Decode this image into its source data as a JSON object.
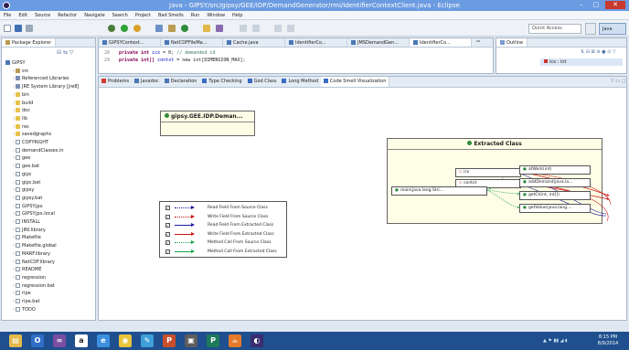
{
  "window": {
    "title": "Java - GIPSY/src/gipsy/GEE/IDP/DemandGenerator/rmi/IdentifierContextClient.java - Eclipse",
    "minimize": "–",
    "maximize": "□",
    "close": "✕"
  },
  "menu": [
    "File",
    "Edit",
    "Source",
    "Refactor",
    "Navigate",
    "Search",
    "Project",
    "Bad Smells",
    "Run",
    "Window",
    "Help"
  ],
  "toolbar": {
    "quick_access": "Quick Access",
    "perspective_java": "Java"
  },
  "package_explorer": {
    "tab": "Package Explorer",
    "tree": [
      {
        "label": "GIPSY",
        "icon": "project-icon",
        "indent": 0
      },
      {
        "label": "src",
        "icon": "package-folder-icon",
        "indent": 1
      },
      {
        "label": "Referenced Libraries",
        "icon": "library-icon",
        "indent": 1
      },
      {
        "label": "JRE System Library [jre8]",
        "icon": "library-icon",
        "indent": 1
      },
      {
        "label": "bin",
        "icon": "folder-icon",
        "indent": 1
      },
      {
        "label": "build",
        "icon": "folder-icon",
        "indent": 1
      },
      {
        "label": "doc",
        "icon": "folder-icon",
        "indent": 1
      },
      {
        "label": "lib",
        "icon": "folder-icon",
        "indent": 1
      },
      {
        "label": "res",
        "icon": "folder-icon",
        "indent": 1
      },
      {
        "label": "savedgraphs",
        "icon": "folder-icon",
        "indent": 1
      },
      {
        "label": "COPYRIGHT",
        "icon": "file-icon",
        "indent": 1
      },
      {
        "label": "demandClasses.in",
        "icon": "file-icon",
        "indent": 1
      },
      {
        "label": "gee",
        "icon": "file-icon",
        "indent": 1
      },
      {
        "label": "gee.bat",
        "icon": "file-icon",
        "indent": 1
      },
      {
        "label": "gipc",
        "icon": "file-icon",
        "indent": 1
      },
      {
        "label": "gipc.bat",
        "icon": "file-icon",
        "indent": 1
      },
      {
        "label": "gipsy",
        "icon": "file-icon",
        "indent": 1
      },
      {
        "label": "gipsy.bat",
        "icon": "file-icon",
        "indent": 1
      },
      {
        "label": "GIPSY.jpx",
        "icon": "file-icon",
        "indent": 1
      },
      {
        "label": "GIPSY.jpx.local",
        "icon": "file-icon",
        "indent": 1
      },
      {
        "label": "INSTALL",
        "icon": "file-icon",
        "indent": 1
      },
      {
        "label": "JINI.library",
        "icon": "file-icon",
        "indent": 1
      },
      {
        "label": "Makefile",
        "icon": "file-icon",
        "indent": 1
      },
      {
        "label": "Makefile.global",
        "icon": "file-icon",
        "indent": 1
      },
      {
        "label": "MARF.library",
        "icon": "file-icon",
        "indent": 1
      },
      {
        "label": "NetCDF.library",
        "icon": "file-icon",
        "indent": 1
      },
      {
        "label": "README",
        "icon": "file-icon",
        "indent": 1
      },
      {
        "label": "regression",
        "icon": "file-icon",
        "indent": 1
      },
      {
        "label": "regression.bat",
        "icon": "file-icon",
        "indent": 1
      },
      {
        "label": "ripe",
        "icon": "file-icon",
        "indent": 1
      },
      {
        "label": "ripe.bat",
        "icon": "file-icon",
        "indent": 1
      },
      {
        "label": "TODO",
        "icon": "file-icon",
        "indent": 1
      }
    ]
  },
  "editor": {
    "tabs": [
      "GIPSYContext...",
      "NetCDFFileMa...",
      "Cache.java",
      "IdentifierCo...",
      "JMSDemandGen...",
      "IdentifierCo..."
    ],
    "overflow_count": "²⁶",
    "lines": [
      {
        "num": "28",
        "keyword": "private int",
        "field": "icx",
        "rest": " = 0;",
        "comment": "// demanded id"
      },
      {
        "num": "29",
        "keyword": "private int[]",
        "field": "contxt",
        "rest": " = new int[DIMENSION_MAX];",
        "comment": ""
      }
    ]
  },
  "outline": {
    "tab": "Outline",
    "item": "icx : int"
  },
  "bottom_tabs": [
    "Problems",
    "Javadoc",
    "Declaration",
    "Type Checking",
    "God Class",
    "Long Method",
    "Code Smell Visualization"
  ],
  "diagram": {
    "source_class": "gipsy.GEE.IDP.Deman...",
    "extracted_class": "Extracted Class",
    "fields": [
      "icx",
      "contxt"
    ],
    "source_method": "main(java.lang.Stri...",
    "methods": [
      "atWork(int)",
      "addDemand(java.la...",
      "getCt(int, int[])",
      "getValue(java.lang...."
    ]
  },
  "legend": [
    {
      "label": "Read Field From Source Class",
      "color": "#1a1a9e",
      "style": "dotted"
    },
    {
      "label": "Write Field From Source Class",
      "color": "#cc1111",
      "style": "dotted"
    },
    {
      "label": "Read Field From Extracted Class",
      "color": "#1a1a9e",
      "style": "solid"
    },
    {
      "label": "Write Field From Extracted Class",
      "color": "#cc1111",
      "style": "solid"
    },
    {
      "label": "Method Call From Source Class",
      "color": "#16a34a",
      "style": "dotted"
    },
    {
      "label": "Method Call From Extracted Class",
      "color": "#16a34a",
      "style": "solid"
    }
  ],
  "taskbar": {
    "clock_time": "8:15 PM",
    "clock_date": "8/9/2014",
    "apps": [
      "file-explorer-icon",
      "outlook-icon",
      "visual-studio-icon",
      "amazon-icon",
      "internet-explorer-icon",
      "chrome-icon",
      "paint-icon",
      "powerpoint-icon",
      "unknown-app-icon",
      "publisher-icon",
      "java-icon",
      "eclipse-icon"
    ]
  },
  "colors": {
    "titlebar": "#6b9be0",
    "taskbar": "#1f4f8e",
    "extracted_box": "#fefee6"
  }
}
